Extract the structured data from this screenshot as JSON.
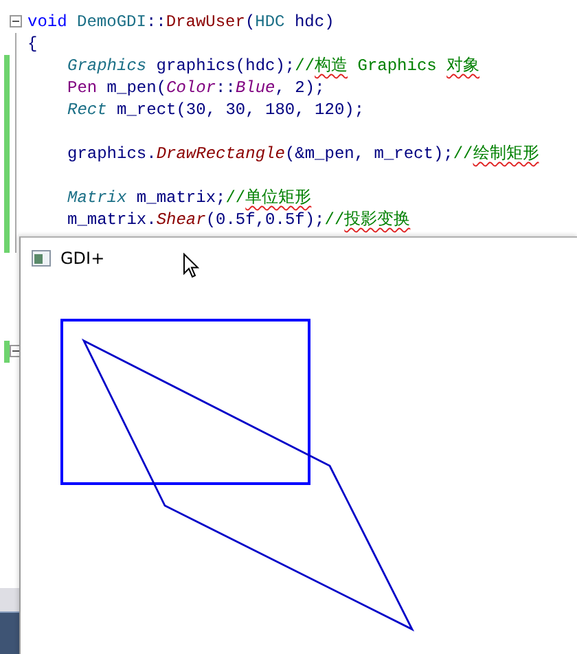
{
  "editor": {
    "lines": [
      {
        "collapsible": true,
        "changed": false,
        "indent": false,
        "tokens": [
          {
            "text": "void ",
            "kind": "keyword"
          },
          {
            "text": "DemoGDI",
            "kind": "class"
          },
          {
            "text": "::",
            "kind": "plain"
          },
          {
            "text": "DrawUser",
            "kind": "function"
          },
          {
            "text": "(",
            "kind": "plain"
          },
          {
            "text": "HDC",
            "kind": "class"
          },
          {
            "text": " hdc)",
            "kind": "plain"
          }
        ]
      },
      {
        "collapsible": false,
        "changed": false,
        "indent": false,
        "tokens": [
          {
            "text": "{",
            "kind": "plain"
          }
        ]
      },
      {
        "collapsible": false,
        "changed": true,
        "indent": true,
        "tokens": [
          {
            "text": "Graphics",
            "kind": "type"
          },
          {
            "text": " graphics(hdc);",
            "kind": "plain"
          },
          {
            "text": "//",
            "kind": "comment"
          },
          {
            "text": "构造",
            "kind": "comment-flagged"
          },
          {
            "text": " Graphics ",
            "kind": "comment"
          },
          {
            "text": "对象",
            "kind": "comment-flagged"
          }
        ]
      },
      {
        "collapsible": false,
        "changed": true,
        "indent": true,
        "tokens": [
          {
            "text": "Pen",
            "kind": "macro"
          },
          {
            "text": " m_pen(",
            "kind": "plain"
          },
          {
            "text": "Color",
            "kind": "enum"
          },
          {
            "text": "::",
            "kind": "plain"
          },
          {
            "text": "Blue",
            "kind": "enum"
          },
          {
            "text": ", 2);",
            "kind": "plain"
          }
        ]
      },
      {
        "collapsible": false,
        "changed": true,
        "indent": true,
        "tokens": [
          {
            "text": "Rect",
            "kind": "type"
          },
          {
            "text": " m_rect(30, 30, 180, 120);",
            "kind": "plain"
          }
        ]
      },
      {
        "collapsible": false,
        "changed": true
      },
      {
        "collapsible": false,
        "changed": true,
        "indent": true,
        "tokens": [
          {
            "text": "graphics.",
            "kind": "plain"
          },
          {
            "text": "DrawRectangle",
            "kind": "method"
          },
          {
            "text": "(&m_pen, m_rect);",
            "kind": "plain"
          },
          {
            "text": "//",
            "kind": "comment"
          },
          {
            "text": "绘制矩形",
            "kind": "comment-flagged"
          }
        ]
      },
      {
        "collapsible": false,
        "changed": true
      },
      {
        "collapsible": false,
        "changed": true,
        "indent": true,
        "tokens": [
          {
            "text": "Matrix",
            "kind": "type"
          },
          {
            "text": " m_matrix;",
            "kind": "plain"
          },
          {
            "text": "//",
            "kind": "comment"
          },
          {
            "text": "单位矩形",
            "kind": "comment-flagged"
          }
        ]
      },
      {
        "collapsible": false,
        "changed": true,
        "indent": true,
        "tokens": [
          {
            "text": "m_matrix.",
            "kind": "plain"
          },
          {
            "text": "Shear",
            "kind": "method"
          },
          {
            "text": "(0.5f,0.5f);",
            "kind": "plain"
          },
          {
            "text": "//",
            "kind": "comment"
          },
          {
            "text": "投影变换",
            "kind": "comment-flagged"
          }
        ]
      },
      {
        "collapsible": false,
        "changed": true
      }
    ],
    "lower_line": {
      "collapsible": true,
      "changed": true
    }
  },
  "window": {
    "title": "GDI+"
  }
}
